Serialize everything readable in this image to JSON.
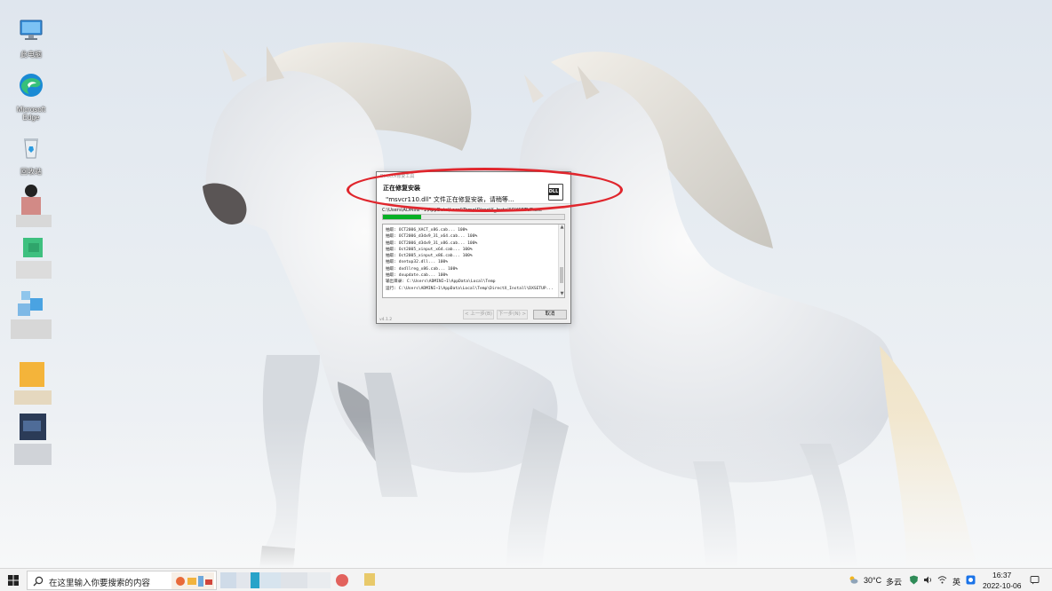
{
  "desktop": {
    "icons": [
      {
        "label": "此电脑",
        "icon": "computer-icon"
      },
      {
        "label": "Microsoft Edge",
        "icon": "edge-icon"
      },
      {
        "label": "回收站",
        "icon": "recycle-bin-icon"
      }
    ]
  },
  "dialog": {
    "title": "DirectX修复工具",
    "heading": "正在修复安装",
    "subheading": "\"msvcr110.dll\" 文件正在修复安装，请稍等...",
    "file_icon_text": "DLL",
    "path": "C:\\Users\\ADMINI~1\\AppData\\Local\\Temp\\DirectX_Install\\DXSETUP.exe",
    "progress_percent": 21,
    "log": [
      "抽取: OCT2006_XACT_x86.cab... 100%",
      "抽取: OCT2006_d3dx9_31_x64.cab... 100%",
      "抽取: OCT2006_d3dx9_31_x86.cab... 100%",
      "抽取: Oct2005_xinput_x64.cab... 100%",
      "抽取: Oct2005_xinput_x86.cab... 100%",
      "抽取: dsetup32.dll... 100%",
      "抽取: dxdllreg_x86.cab... 100%",
      "抽取: dxupdate.cab... 100%",
      "输出目录: C:\\Users\\ADMINI~1\\AppData\\Local\\Temp",
      "运行: C:\\Users\\ADMINI~1\\AppData\\Local\\Temp\\DirectX_Install\\DXSETUP..."
    ],
    "version": "v4.1.2",
    "buttons": {
      "back": "< 上一步(B)",
      "next": "下一步(N) >",
      "cancel": "取消"
    }
  },
  "taskbar": {
    "search_placeholder": "在这里输入你要搜索的内容",
    "weather_temp": "30°C",
    "weather_desc": "多云",
    "ime": "英",
    "time": "16:37",
    "date": "2022-10-06"
  },
  "colors": {
    "progress": "#06b025",
    "annotation": "#e0262d"
  }
}
